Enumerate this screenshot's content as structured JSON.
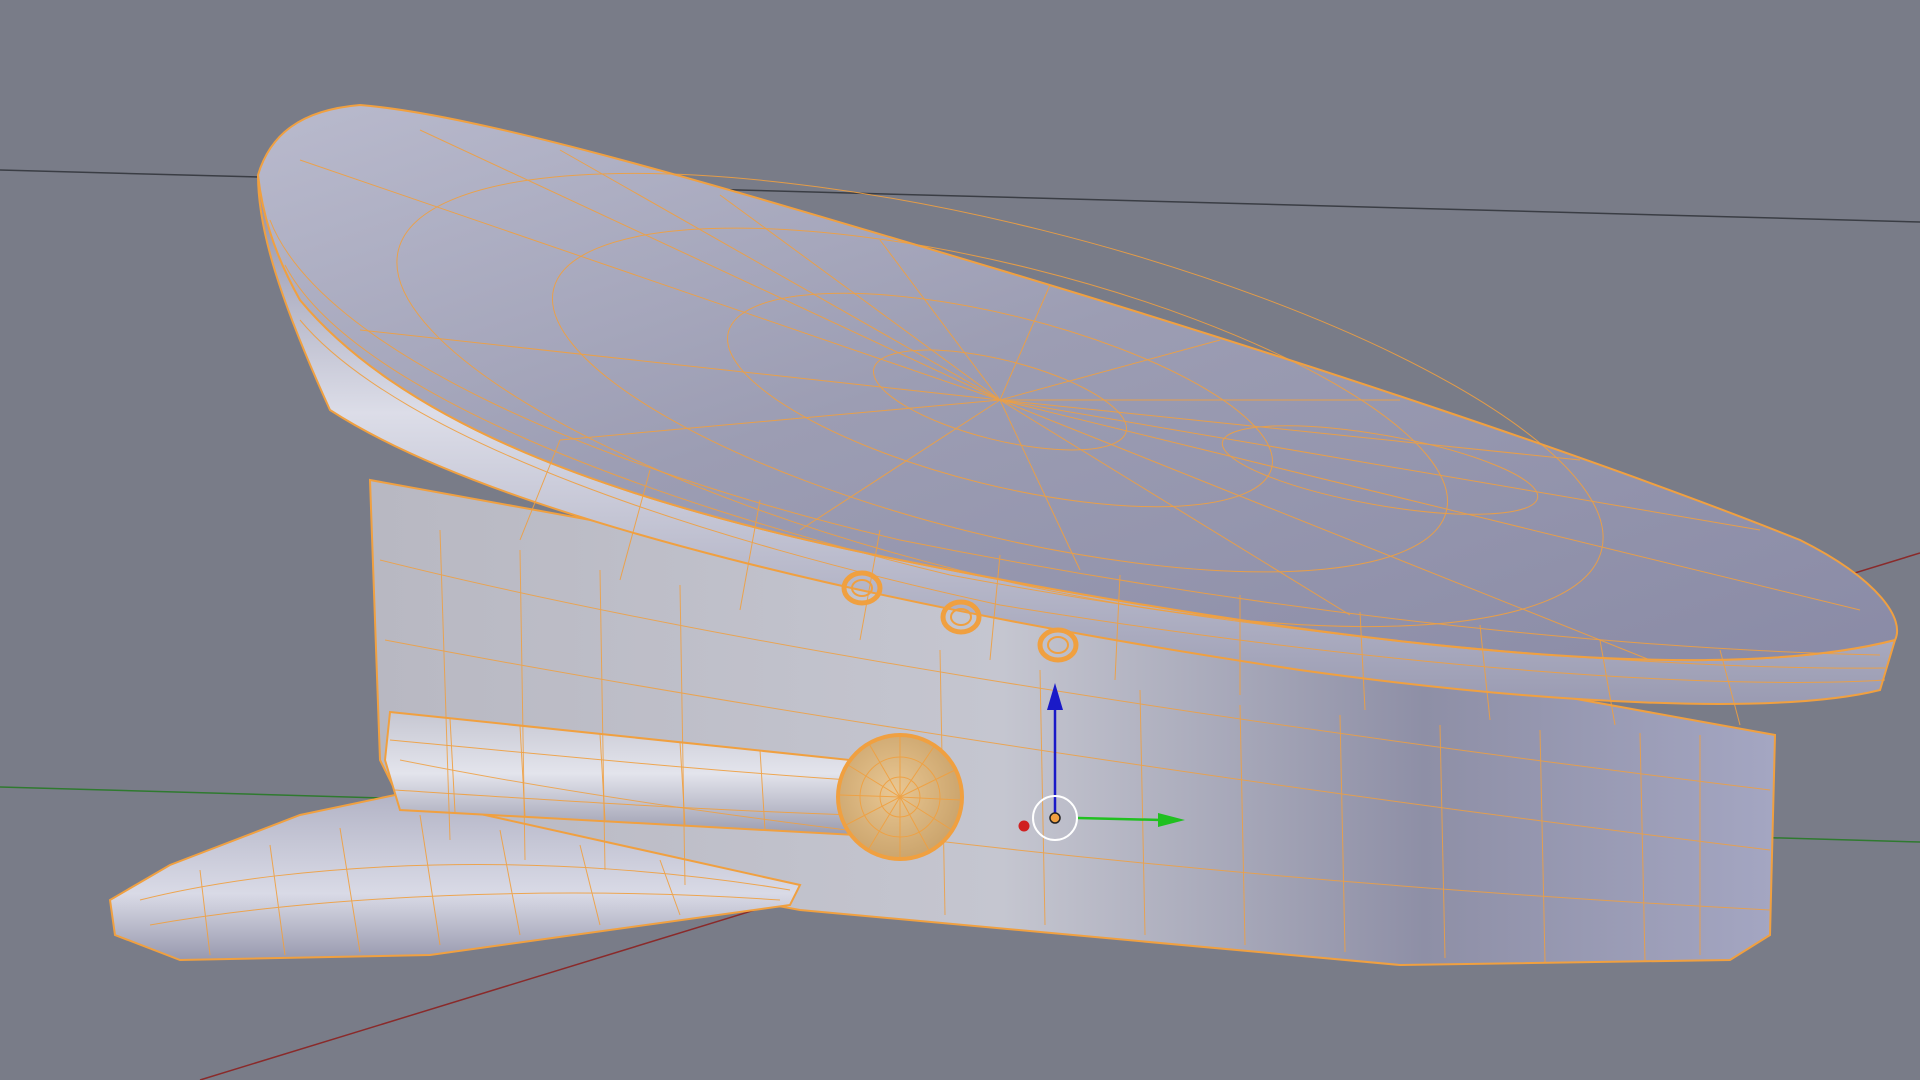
{
  "viewport": {
    "name": "3D Viewport",
    "object": "peaked-cap-mesh",
    "mode": "edit",
    "background_color": "#797c88",
    "selection_color": "#f0a040"
  },
  "axes": {
    "x_color": "#8a2a2a",
    "y_color": "#2f7a2f"
  },
  "gizmo": {
    "type": "translate",
    "x_handle_color": "#d02020",
    "y_handle_color": "#20c020",
    "z_handle_color": "#1a1ac8"
  }
}
